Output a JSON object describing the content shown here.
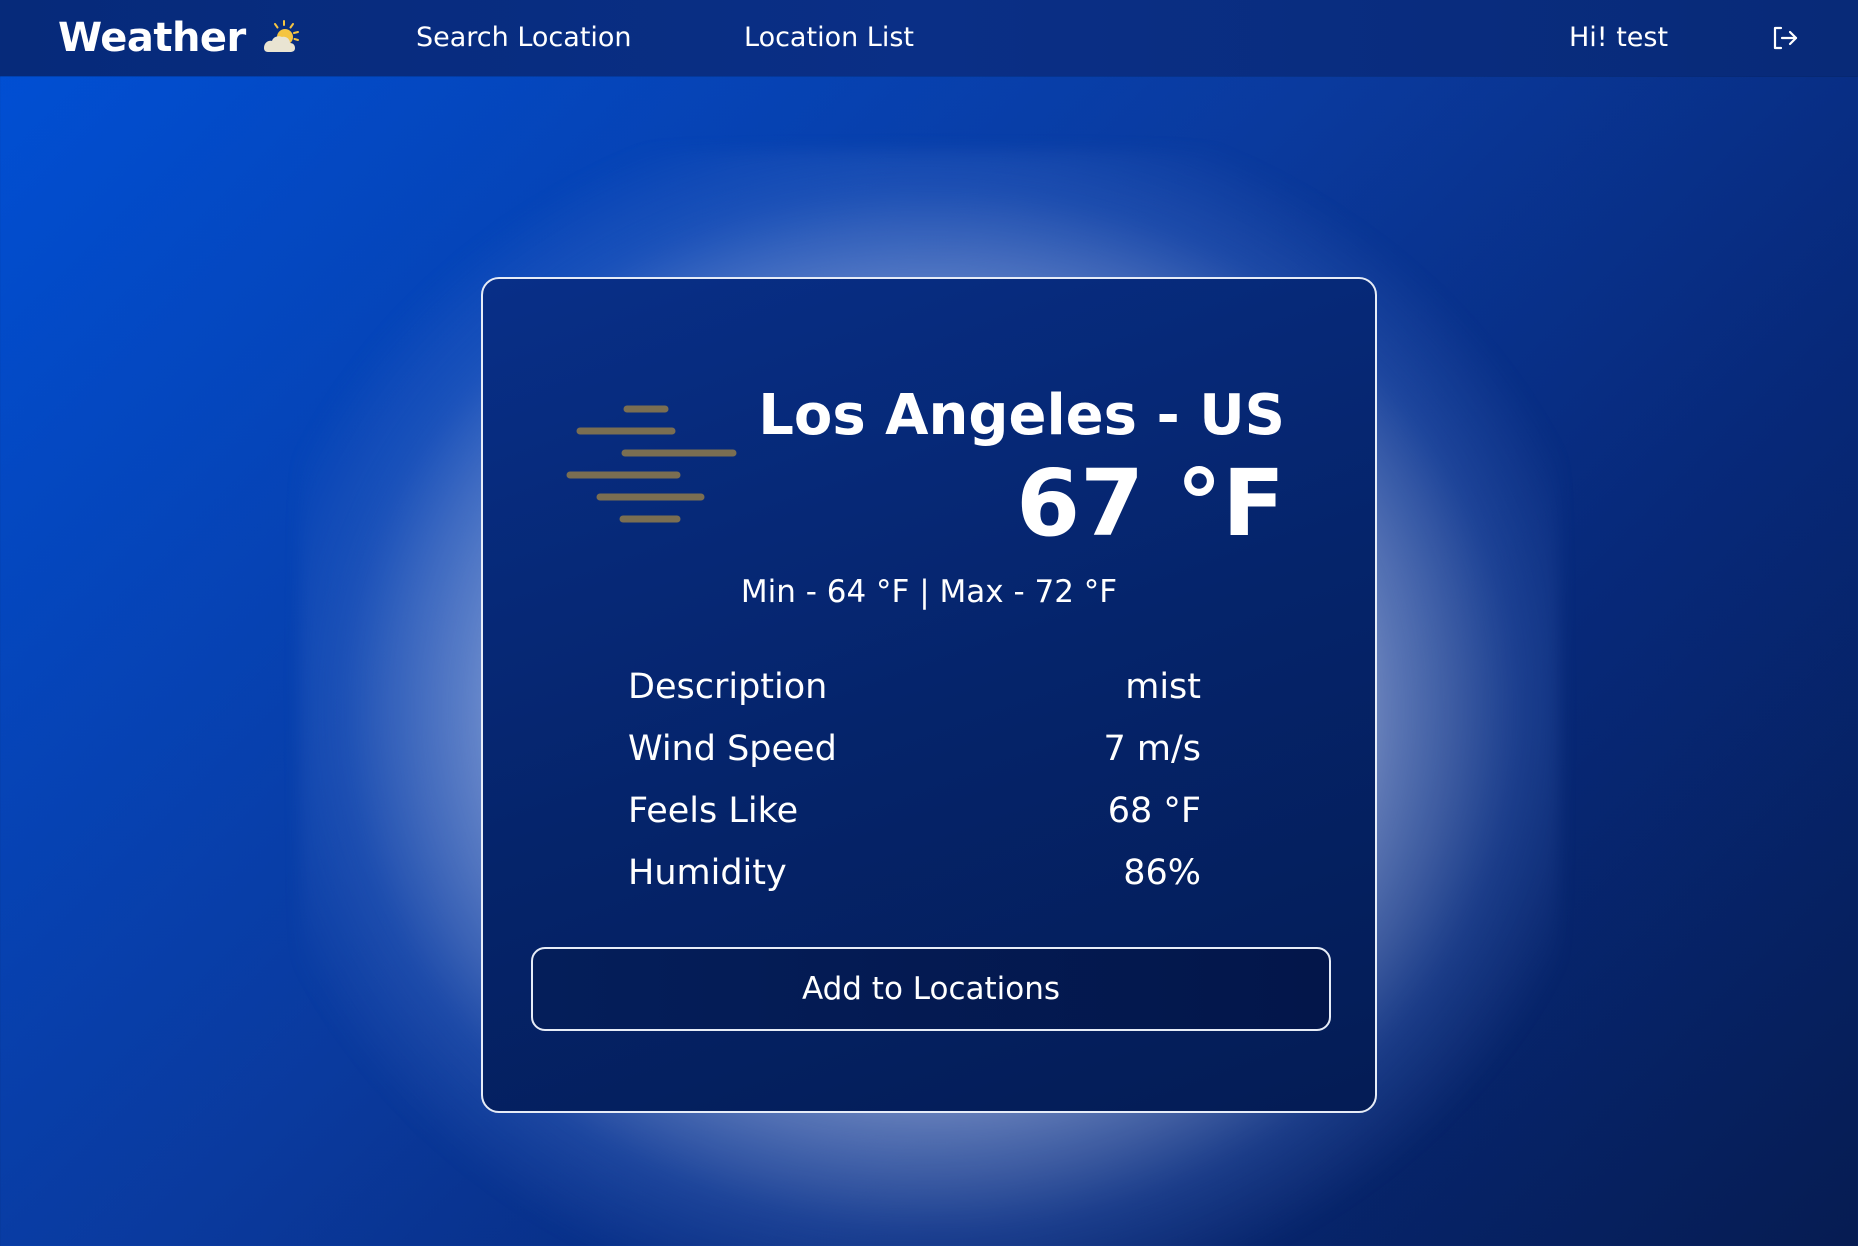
{
  "navbar": {
    "brand": "Weather",
    "brand_icon": "sun-behind-cloud-icon",
    "links": [
      "Search Location",
      "Location List"
    ],
    "greeting": "Hi! test",
    "logout_icon": "logout-icon"
  },
  "weather": {
    "condition_icon": "mist-icon",
    "city": "Los Angeles - US",
    "temperature": "67 °F",
    "min_max": "Min - 64 °F | Max - 72 °F",
    "details": [
      {
        "label": "Description",
        "value": "mist"
      },
      {
        "label": "Wind Speed",
        "value": "7 m/s"
      },
      {
        "label": "Feels Like",
        "value": "68 °F"
      },
      {
        "label": "Humidity",
        "value": "86%"
      }
    ],
    "add_button": "Add to Locations"
  },
  "colors": {
    "background_start": "#0050d6",
    "background_end": "#061c52",
    "navbar": "#082a78",
    "card": "#05246b",
    "card_border": "#e6ecf7",
    "mist_lines": "#7a6e52",
    "sun": "#f5c542"
  }
}
